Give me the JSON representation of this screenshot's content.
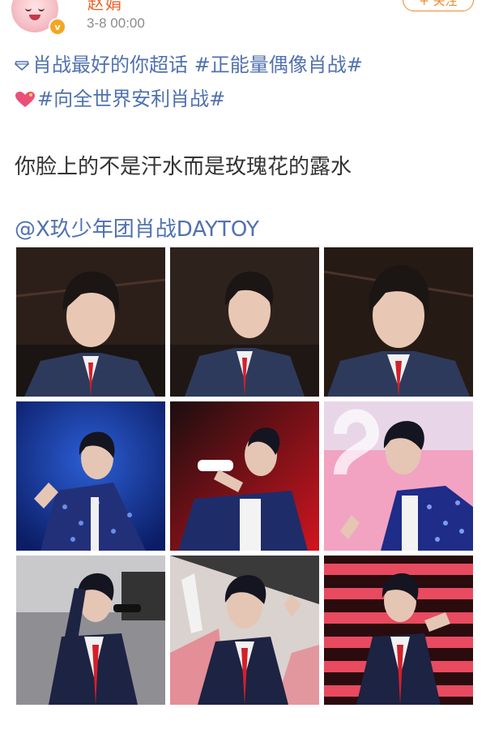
{
  "post": {
    "username": "赵娟",
    "timestamp": "3-8 00:00",
    "follow_label": "+ 关注",
    "tags_line1": "肖战最好的你超话 #正能量偶像肖战#",
    "tags_line2": "#向全世界安利肖战#",
    "body": "你脸上的不是汗水而是玫瑰花的露水",
    "mention": "@X玖少年团肖战DAYTOY"
  },
  "icons": {
    "avatar": "cartoon-avatar",
    "badge": "verified-badge-icon",
    "supertopic": "diamond-icon",
    "heart": "heart-icon"
  },
  "colors": {
    "link": "#5071b0",
    "accent": "#f08a2c",
    "text": "#333333",
    "muted": "#8c8c8c"
  },
  "photos": [
    {
      "theme": "dark-suit"
    },
    {
      "theme": "dark-suit"
    },
    {
      "theme": "dark-suit"
    },
    {
      "theme": "blue-stage"
    },
    {
      "theme": "red-stage"
    },
    {
      "theme": "pink-stage"
    },
    {
      "theme": "gray-stage"
    },
    {
      "theme": "light-stage"
    },
    {
      "theme": "striped-stage"
    }
  ]
}
